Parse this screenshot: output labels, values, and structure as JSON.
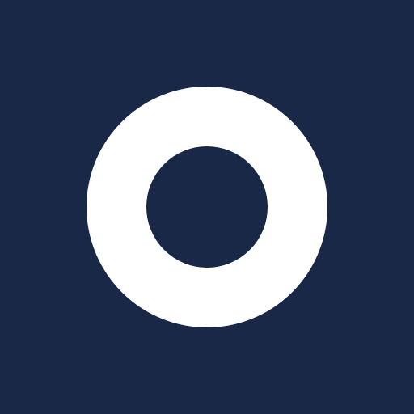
{
  "logo": {
    "icon": "ring-icon",
    "background_color": "#182846",
    "ring_color": "#ffffff"
  }
}
